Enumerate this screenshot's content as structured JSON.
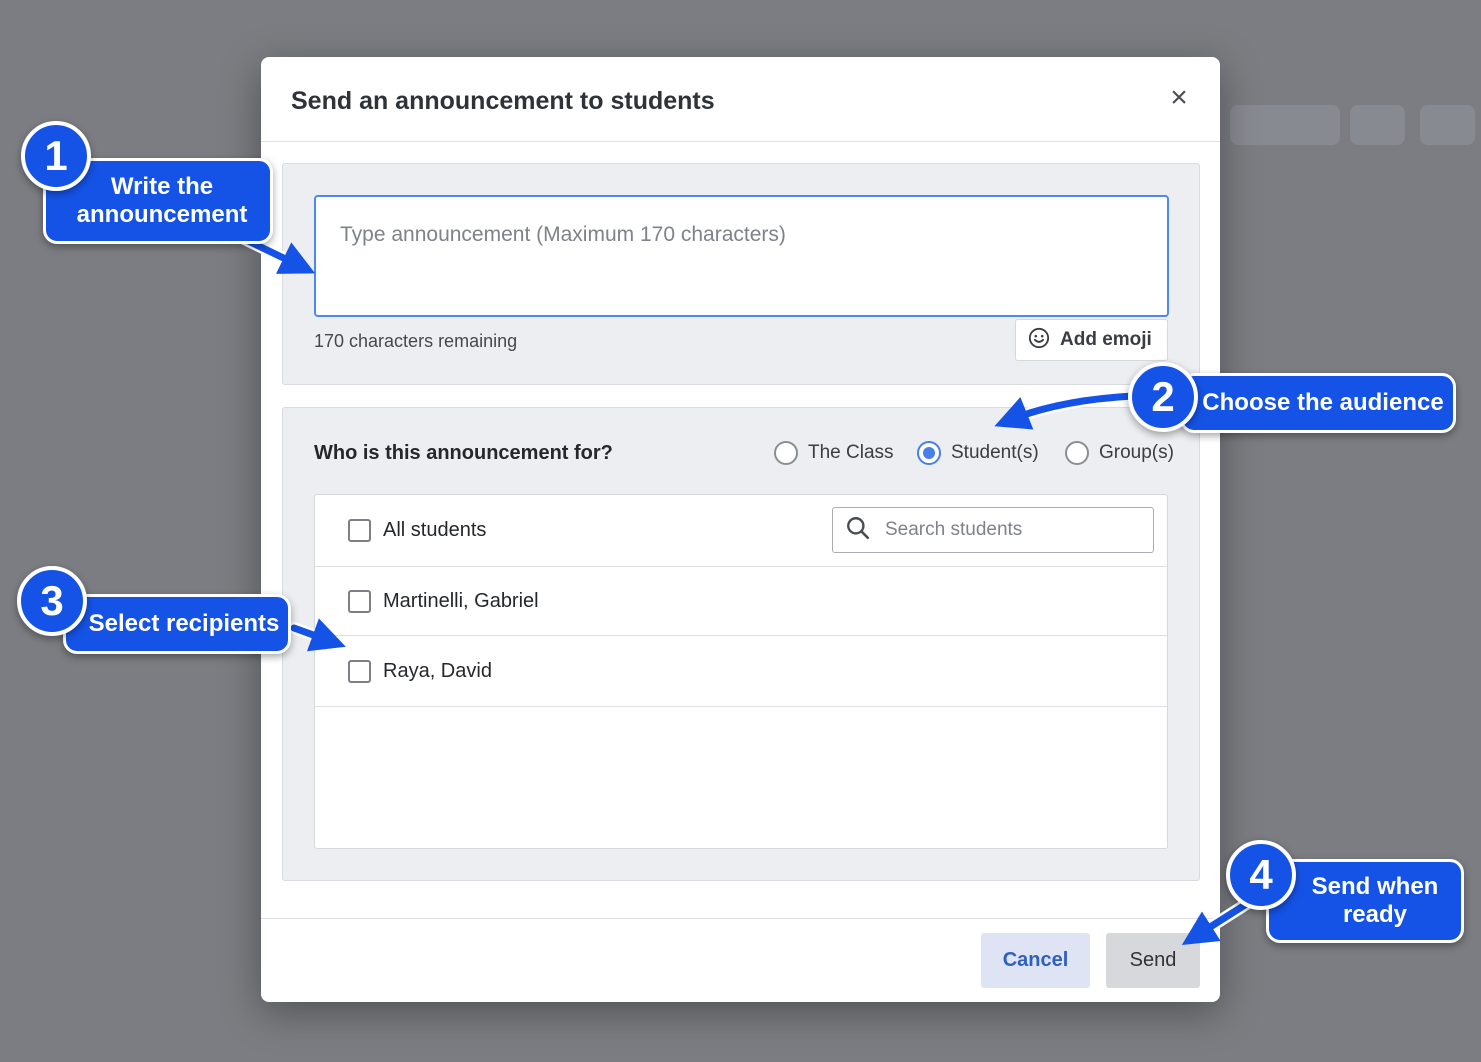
{
  "modal": {
    "title": "Send an announcement to students",
    "close_icon": "close-icon"
  },
  "compose": {
    "placeholder": "Type announcement (Maximum 170 characters)",
    "value": "",
    "remaining": "170 characters remaining",
    "emoji_button": "Add emoji",
    "emoji_icon": "smiley-icon"
  },
  "audience": {
    "question": "Who is this announcement for?",
    "options": [
      {
        "label": "The Class",
        "selected": false
      },
      {
        "label": "Student(s)",
        "selected": true
      },
      {
        "label": "Group(s)",
        "selected": false
      }
    ]
  },
  "students": {
    "all_label": "All students",
    "search_placeholder": "Search students",
    "search_icon": "search-icon",
    "rows": [
      {
        "name": "Martinelli, Gabriel",
        "checked": false
      },
      {
        "name": "Raya, David",
        "checked": false
      }
    ]
  },
  "footer": {
    "cancel": "Cancel",
    "send": "Send"
  },
  "callouts": [
    {
      "number": "1",
      "text": "Write the announcement"
    },
    {
      "number": "2",
      "text": "Choose the audience"
    },
    {
      "number": "3",
      "text": "Select recipients"
    },
    {
      "number": "4",
      "text": "Send when ready"
    }
  ],
  "colors": {
    "accent": "#1553e6",
    "focus_border": "#4a8af0",
    "radio_selected": "#4a7ee8",
    "overlay": "#7b7d82"
  }
}
